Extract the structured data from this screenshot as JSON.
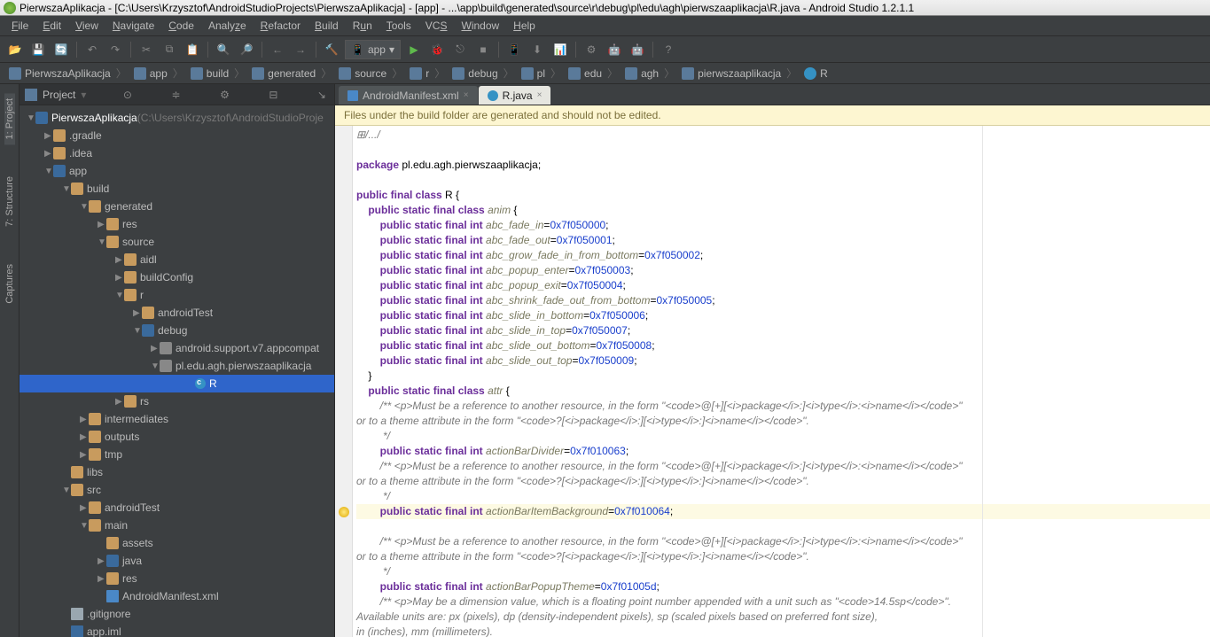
{
  "title": "PierwszaAplikacja - [C:\\Users\\Krzysztof\\AndroidStudioProjects\\PierwszaAplikacja] - [app] - ...\\app\\build\\generated\\source\\r\\debug\\pl\\edu\\agh\\pierwszaaplikacja\\R.java - Android Studio 1.2.1.1",
  "menu": [
    "File",
    "Edit",
    "View",
    "Navigate",
    "Code",
    "Analyze",
    "Refactor",
    "Build",
    "Run",
    "Tools",
    "VCS",
    "Window",
    "Help"
  ],
  "run_config": "app",
  "breadcrumbs": [
    "PierwszaAplikacja",
    "app",
    "build",
    "generated",
    "source",
    "r",
    "debug",
    "pl",
    "edu",
    "agh",
    "pierwszaaplikacja",
    "R"
  ],
  "panel": {
    "title": "Project"
  },
  "sidebar_tabs": [
    "1: Project",
    "7: Structure",
    "Captures"
  ],
  "tree": {
    "root": "PierwszaAplikacja",
    "root_path": "(C:\\Users\\Krzysztof\\AndroidStudioProje",
    "items": [
      ".gradle",
      ".idea",
      "app",
      "build",
      "generated",
      "res",
      "source",
      "aidl",
      "buildConfig",
      "r",
      "androidTest",
      "debug",
      "android.support.v7.appcompat",
      "pl.edu.agh.pierwszaaplikacja",
      "R",
      "rs",
      "intermediates",
      "outputs",
      "tmp",
      "libs",
      "src",
      "androidTest",
      "main",
      "assets",
      "java",
      "res",
      "AndroidManifest.xml",
      ".gitignore",
      "app.iml"
    ]
  },
  "tabs": [
    {
      "label": "AndroidManifest.xml",
      "active": false
    },
    {
      "label": "R.java",
      "active": true
    }
  ],
  "banner": "Files under the build folder are generated and should not be edited.",
  "code": {
    "pkg": "package pl.edu.agh.pierwszaaplikacja;",
    "class_decl": "public final class R {",
    "anim_decl": "public static final class anim {",
    "fields": [
      {
        "name": "abc_fade_in",
        "val": "0x7f050000"
      },
      {
        "name": "abc_fade_out",
        "val": "0x7f050001"
      },
      {
        "name": "abc_grow_fade_in_from_bottom",
        "val": "0x7f050002"
      },
      {
        "name": "abc_popup_enter",
        "val": "0x7f050003"
      },
      {
        "name": "abc_popup_exit",
        "val": "0x7f050004"
      },
      {
        "name": "abc_shrink_fade_out_from_bottom",
        "val": "0x7f050005"
      },
      {
        "name": "abc_slide_in_bottom",
        "val": "0x7f050006"
      },
      {
        "name": "abc_slide_in_top",
        "val": "0x7f050007"
      },
      {
        "name": "abc_slide_out_bottom",
        "val": "0x7f050008"
      },
      {
        "name": "abc_slide_out_top",
        "val": "0x7f050009"
      }
    ],
    "attr_decl": "public static final class attr {",
    "comment1": "/** <p>Must be a reference to another resource, in the form \"<code>@[+][<i>package</i>:]<i>type</i>:<i>name</i></code>\"\nor to a theme attribute in the form \"<code>?[<i>package</i>:][<i>type</i>:]<i>name</i></code>\".\n         */",
    "attr_fields": [
      {
        "name": "actionBarDivider",
        "val": "0x7f010063"
      },
      {
        "name": "actionBarItemBackground",
        "val": "0x7f010064",
        "hl": true
      },
      {
        "name": "actionBarPopupTheme",
        "val": "0x7f01005d"
      }
    ],
    "comment2": "/** <p>May be a dimension value, which is a floating point number appended with a unit such as \"<code>14.5sp</code>\".\nAvailable units are: px (pixels), dp (density-independent pixels), sp (scaled pixels based on preferred font size),\nin (inches), mm (millimeters)."
  }
}
